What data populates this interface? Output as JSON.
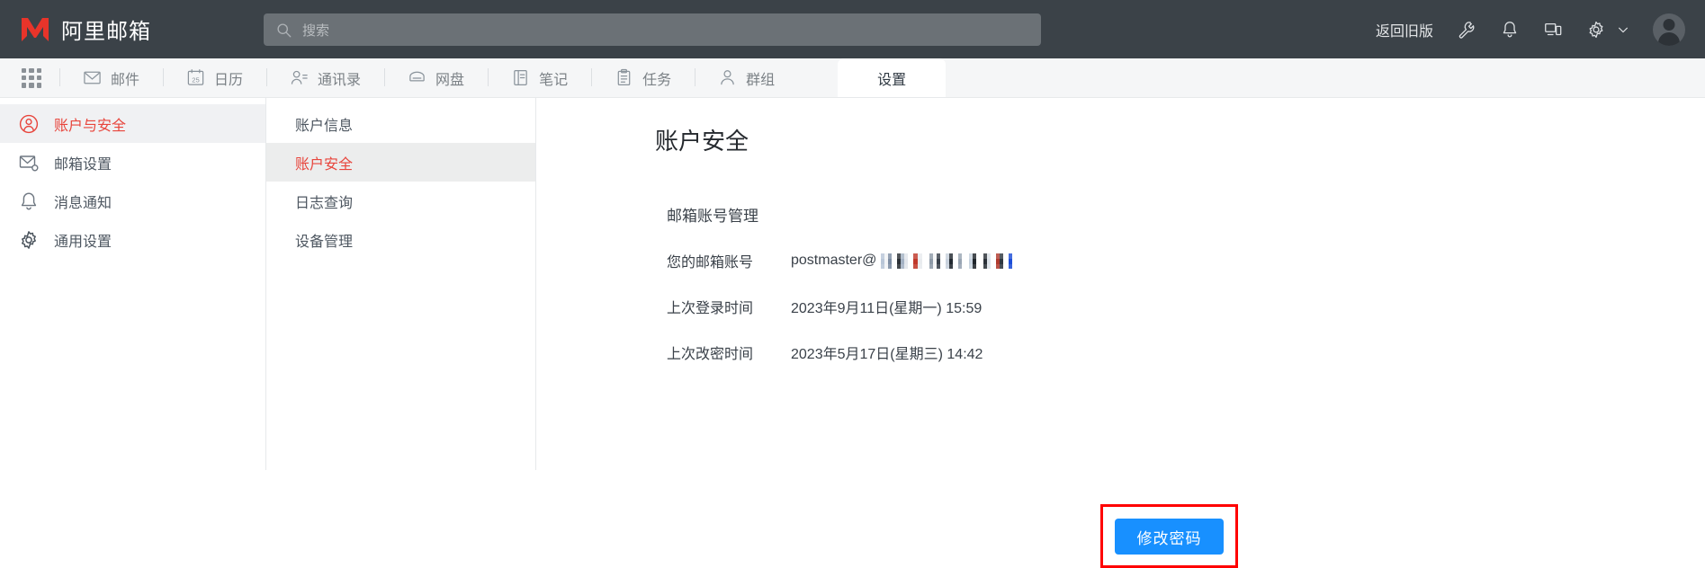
{
  "topbar": {
    "brand_name": "阿里邮箱",
    "logo_icon": "alibaba-m-logo",
    "search": {
      "placeholder": "搜索",
      "value": "",
      "icon": "search-icon"
    },
    "old_version_label": "返回旧版",
    "icons": [
      "wrench-icon",
      "bell-icon",
      "devices-icon",
      "gear-icon",
      "chevron-down-icon",
      "avatar"
    ],
    "bg_color": "#3b4248"
  },
  "appnav": {
    "grid_icon": "app-grid-icon",
    "items": [
      {
        "label": "邮件",
        "icon": "mail-icon"
      },
      {
        "label": "日历",
        "icon": "calendar-icon"
      },
      {
        "label": "通讯录",
        "icon": "contacts-icon"
      },
      {
        "label": "网盘",
        "icon": "cloud-disk-icon"
      },
      {
        "label": "笔记",
        "icon": "notes-icon"
      },
      {
        "label": "任务",
        "icon": "task-icon"
      },
      {
        "label": "群组",
        "icon": "group-icon"
      }
    ],
    "active_tab": "设置"
  },
  "sidebar": {
    "items": [
      {
        "label": "账户与安全",
        "icon": "user-circle-icon",
        "active": true
      },
      {
        "label": "邮箱设置",
        "icon": "mail-gear-icon",
        "active": false
      },
      {
        "label": "消息通知",
        "icon": "bell-icon",
        "active": false
      },
      {
        "label": "通用设置",
        "icon": "gear-icon",
        "active": false
      }
    ]
  },
  "submenu": {
    "items": [
      {
        "label": "账户信息",
        "active": false
      },
      {
        "label": "账户安全",
        "active": true
      },
      {
        "label": "日志查询",
        "active": false
      },
      {
        "label": "设备管理",
        "active": false
      }
    ]
  },
  "main": {
    "page_title": "账户安全",
    "section_heading": "邮箱账号管理",
    "rows": [
      {
        "label": "您的邮箱账号",
        "value": "postmaster@",
        "redacted": true
      },
      {
        "label": "上次登录时间",
        "value": "2023年9月11日(星期一) 15:59",
        "redacted": false
      },
      {
        "label": "上次改密时间",
        "value": "2023年5月17日(星期三) 14:42",
        "redacted": false
      }
    ],
    "change_password_button": "修改密码",
    "button_color": "#1890ff",
    "highlight_color": "#ff0000"
  }
}
